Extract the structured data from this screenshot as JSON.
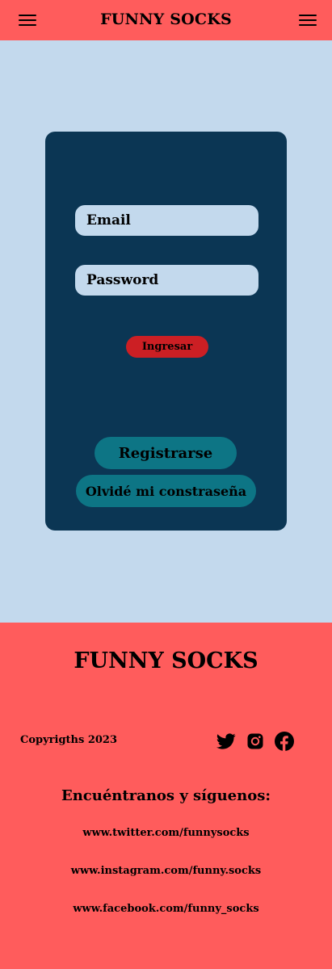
{
  "header": {
    "brand": "FUNNY SOCKS",
    "left_menu_icon": "hamburger-menu-icon",
    "right_menu_icon": "hamburger-menu-icon"
  },
  "login": {
    "email_placeholder": "Email",
    "password_placeholder": "Password",
    "submit_label": "Ingresar",
    "register_label": "Registrarse",
    "forgot_label": "Olvidé mi constraseña"
  },
  "footer": {
    "brand": "FUNNY SOCKS",
    "copyright": "Copyrigths 2023",
    "social_icons": [
      "twitter-icon",
      "instagram-icon",
      "facebook-icon"
    ],
    "find_us": "Encuéntranos y síguenos:",
    "links": [
      "www.twitter.com/funnysocks",
      "www.instagram.com/funny.socks",
      "www.facebook.com/funny_socks"
    ]
  },
  "colors": {
    "header_bg": "#ff5c5c",
    "page_bg": "#c3d9ed",
    "card_bg": "#0b3654",
    "submit_bg": "#cc1f24",
    "secondary_bg": "#0d7585"
  }
}
